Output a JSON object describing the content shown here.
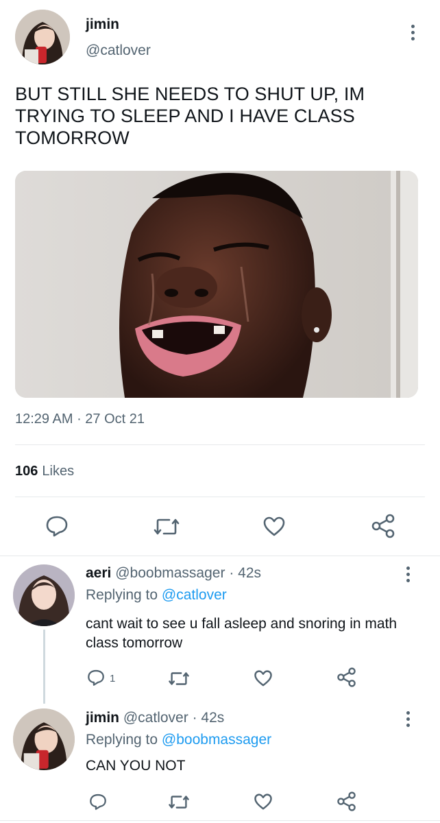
{
  "main_tweet": {
    "name": "jimin",
    "handle": "@catlover",
    "text": "BUT STILL SHE NEEDS TO SHUT UP, IM TRYING TO SLEEP AND I HAVE CLASS TOMORROW",
    "time": "12:29 AM",
    "separator": " · ",
    "date": "27 Oct 21",
    "likes_count": "106",
    "likes_label": "Likes"
  },
  "replies": [
    {
      "name": "aeri",
      "handle": "@boobmassager",
      "time": "· 42s",
      "replying_prefix": "Replying to ",
      "replying_to": "@catlover",
      "text": "cant wait to see u fall asleep and snoring in math class tomorrow",
      "reply_count": "1"
    },
    {
      "name": "jimin",
      "handle": "@catlover",
      "time": "· 42s",
      "replying_prefix": "Replying to ",
      "replying_to": "@boobmassager",
      "text": "CAN YOU NOT",
      "reply_count": ""
    }
  ],
  "icons": {
    "reply": "reply-icon",
    "retweet": "retweet-icon",
    "like": "heart-icon",
    "share": "share-icon",
    "more": "more-icon"
  },
  "colors": {
    "text": "#0f1419",
    "secondary": "#536471",
    "link": "#1d9bf0",
    "divider": "#e6e9eb"
  }
}
